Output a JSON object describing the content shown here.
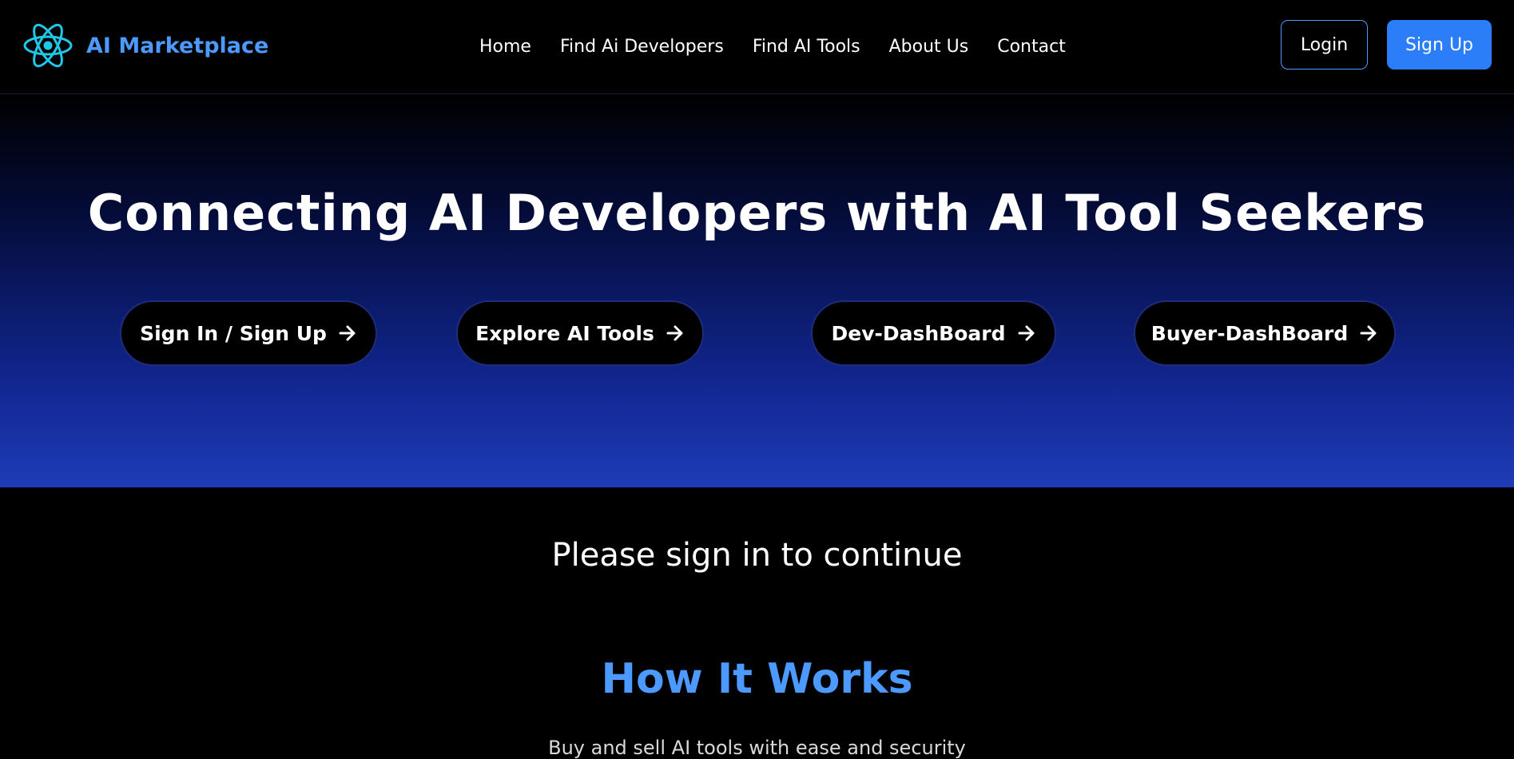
{
  "header": {
    "brand_name": "AI Marketplace",
    "logo_icon": "atom-icon",
    "nav": [
      "Home",
      "Find Ai Developers",
      "Find AI Tools",
      "About Us",
      "Contact"
    ],
    "login_label": "Login",
    "signup_label": "Sign Up"
  },
  "hero": {
    "title": "Connecting AI Developers with AI Tool Seekers",
    "buttons": [
      {
        "label": "Sign In / Sign Up",
        "icon": "arrow-right-icon"
      },
      {
        "label": "Explore AI Tools",
        "icon": "arrow-right-icon"
      },
      {
        "label": "Dev-DashBoard",
        "icon": "arrow-right-icon"
      },
      {
        "label": "Buyer-DashBoard",
        "icon": "arrow-right-icon"
      }
    ]
  },
  "main": {
    "signin_message": "Please sign in to continue",
    "how_title": "How It Works",
    "how_subtitle": "Buy and sell AI tools with ease and security"
  },
  "colors": {
    "brand": "#4c99ff",
    "signup_button": "#2c7ef8",
    "logo": "#1ec8e6",
    "hero_gradient_end": "#1e3cb8"
  }
}
